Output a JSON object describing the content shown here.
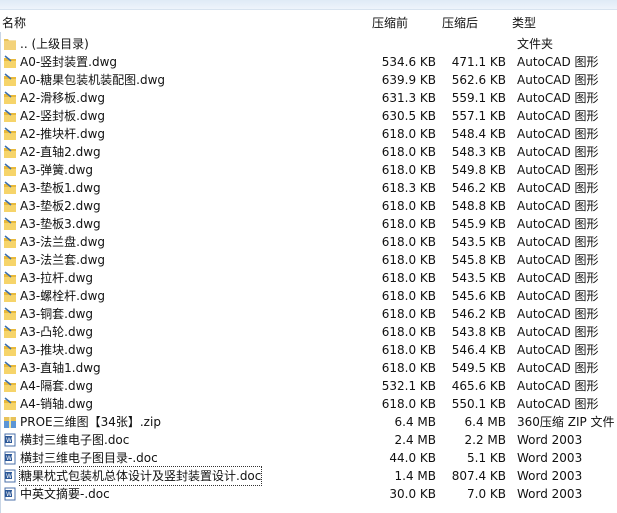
{
  "columns": {
    "name": "名称",
    "pre": "压缩前",
    "post": "压缩后",
    "type": "类型"
  },
  "rows": [
    {
      "name": ".. (上级目录)",
      "pre": "",
      "post": "",
      "type": "文件夹",
      "icon": "folder-icon"
    },
    {
      "name": "A0-竖封装置.dwg",
      "pre": "534.6 KB",
      "post": "471.1 KB",
      "type": "AutoCAD 图形",
      "icon": "dwg-icon"
    },
    {
      "name": "A0-糖果包装机装配图.dwg",
      "pre": "639.9 KB",
      "post": "562.6 KB",
      "type": "AutoCAD 图形",
      "icon": "dwg-icon"
    },
    {
      "name": "A2-滑移板.dwg",
      "pre": "631.3 KB",
      "post": "559.1 KB",
      "type": "AutoCAD 图形",
      "icon": "dwg-icon"
    },
    {
      "name": "A2-竖封板.dwg",
      "pre": "630.5 KB",
      "post": "557.1 KB",
      "type": "AutoCAD 图形",
      "icon": "dwg-icon"
    },
    {
      "name": "A2-推块杆.dwg",
      "pre": "618.0 KB",
      "post": "548.4 KB",
      "type": "AutoCAD 图形",
      "icon": "dwg-icon"
    },
    {
      "name": "A2-直轴2.dwg",
      "pre": "618.0 KB",
      "post": "548.3 KB",
      "type": "AutoCAD 图形",
      "icon": "dwg-icon"
    },
    {
      "name": "A3-弹簧.dwg",
      "pre": "618.0 KB",
      "post": "549.8 KB",
      "type": "AutoCAD 图形",
      "icon": "dwg-icon"
    },
    {
      "name": "A3-垫板1.dwg",
      "pre": "618.3 KB",
      "post": "546.2 KB",
      "type": "AutoCAD 图形",
      "icon": "dwg-icon"
    },
    {
      "name": "A3-垫板2.dwg",
      "pre": "618.0 KB",
      "post": "548.8 KB",
      "type": "AutoCAD 图形",
      "icon": "dwg-icon"
    },
    {
      "name": "A3-垫板3.dwg",
      "pre": "618.0 KB",
      "post": "545.9 KB",
      "type": "AutoCAD 图形",
      "icon": "dwg-icon"
    },
    {
      "name": "A3-法兰盘.dwg",
      "pre": "618.0 KB",
      "post": "543.5 KB",
      "type": "AutoCAD 图形",
      "icon": "dwg-icon"
    },
    {
      "name": "A3-法兰套.dwg",
      "pre": "618.0 KB",
      "post": "545.8 KB",
      "type": "AutoCAD 图形",
      "icon": "dwg-icon"
    },
    {
      "name": "A3-拉杆.dwg",
      "pre": "618.0 KB",
      "post": "543.5 KB",
      "type": "AutoCAD 图形",
      "icon": "dwg-icon"
    },
    {
      "name": "A3-螺栓杆.dwg",
      "pre": "618.0 KB",
      "post": "545.6 KB",
      "type": "AutoCAD 图形",
      "icon": "dwg-icon"
    },
    {
      "name": "A3-铜套.dwg",
      "pre": "618.0 KB",
      "post": "546.2 KB",
      "type": "AutoCAD 图形",
      "icon": "dwg-icon"
    },
    {
      "name": "A3-凸轮.dwg",
      "pre": "618.0 KB",
      "post": "543.8 KB",
      "type": "AutoCAD 图形",
      "icon": "dwg-icon"
    },
    {
      "name": "A3-推块.dwg",
      "pre": "618.0 KB",
      "post": "546.4 KB",
      "type": "AutoCAD 图形",
      "icon": "dwg-icon"
    },
    {
      "name": "A3-直轴1.dwg",
      "pre": "618.0 KB",
      "post": "549.5 KB",
      "type": "AutoCAD 图形",
      "icon": "dwg-icon"
    },
    {
      "name": "A4-隔套.dwg",
      "pre": "532.1 KB",
      "post": "465.6 KB",
      "type": "AutoCAD 图形",
      "icon": "dwg-icon"
    },
    {
      "name": "A4-销轴.dwg",
      "pre": "618.0 KB",
      "post": "550.1 KB",
      "type": "AutoCAD 图形",
      "icon": "dwg-icon"
    },
    {
      "name": "PROE三维图【34张】.zip",
      "pre": "6.4 MB",
      "post": "6.4 MB",
      "type": "360压缩 ZIP 文件",
      "icon": "zip-icon"
    },
    {
      "name": "横封三维电子图.doc",
      "pre": "2.4 MB",
      "post": "2.2 MB",
      "type": "Word 2003",
      "icon": "word-icon"
    },
    {
      "name": "横封三维电子图目录-.doc",
      "pre": "44.0 KB",
      "post": "5.1 KB",
      "type": "Word 2003",
      "icon": "word-icon"
    },
    {
      "name": "糖果枕式包装机总体设计及竖封装置设计.doc",
      "pre": "1.4 MB",
      "post": "807.4 KB",
      "type": "Word 2003",
      "icon": "word-icon",
      "selected": true
    },
    {
      "name": "中英文摘要-.doc",
      "pre": "30.0 KB",
      "post": "7.0 KB",
      "type": "Word 2003",
      "icon": "word-icon"
    }
  ]
}
